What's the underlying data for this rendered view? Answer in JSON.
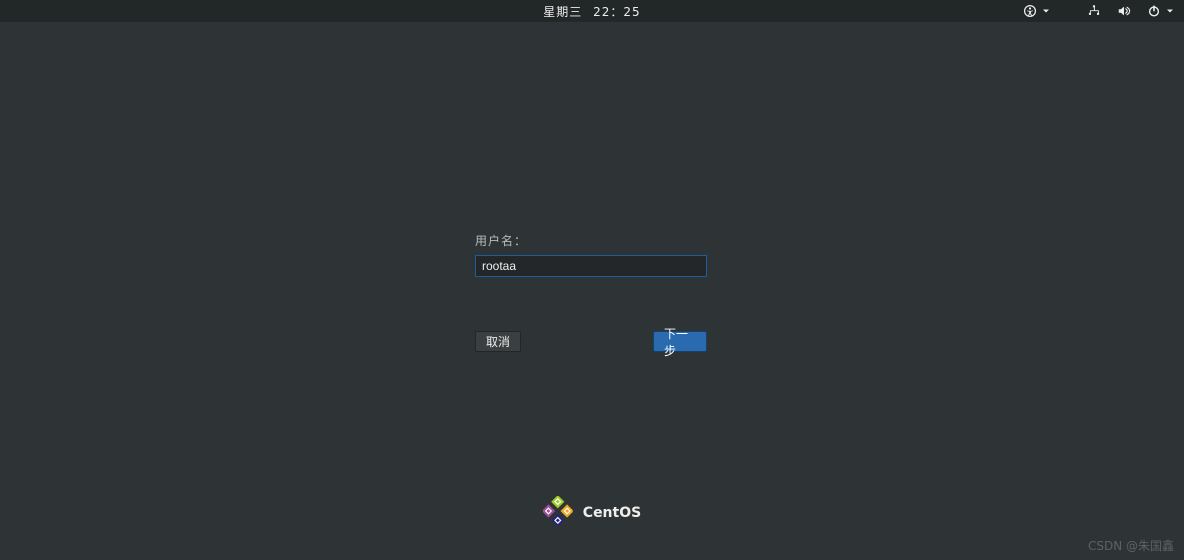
{
  "topbar": {
    "day": "星期三",
    "time": "22：25"
  },
  "login": {
    "username_label": "用户名：",
    "username_value": "rootaa",
    "cancel_label": "取消",
    "next_label": "下一步"
  },
  "branding": {
    "name": "CentOS"
  },
  "watermark": "CSDN @朱国鑫"
}
